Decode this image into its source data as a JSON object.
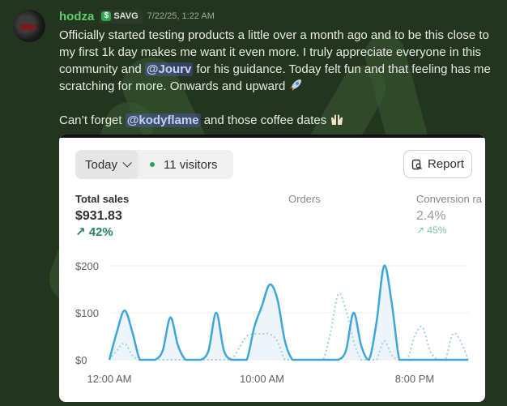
{
  "message": {
    "username": "hodza",
    "server_tag": "SAVG",
    "timestamp": "7/22/25, 1:22 AM",
    "line1_a": "Officially started testing products a little over a month ago and to be this close to my first 1k day makes me want it even more. I truly appreciate everyone in this community and ",
    "mention1": "@Jourv",
    "line1_b": " for his guidance. Today felt fun and that feeling has me scratching for more. Onwards and upward ",
    "line2_a": "Can’t forget ",
    "mention2": "@kodyflame",
    "line2_b": " and those coffee dates ",
    "emoji1": "rocket-icon",
    "emoji2": "raised-hands-icon"
  },
  "dashboard": {
    "range_label": "Today",
    "visitors": "11 visitors",
    "report_label": "Report",
    "metrics": [
      {
        "label": "Total sales",
        "value": "$931.83",
        "change": "↗ 42%"
      },
      {
        "label": "Orders",
        "value": "",
        "change": ""
      },
      {
        "label": "Conversion ra",
        "value": "2.4%",
        "change": "↗ 45%"
      }
    ],
    "colors": {
      "primary_line": "#3ea6d8",
      "comparison_line": "#9fd0ea",
      "fill": "#e8f3fa",
      "positive": "#29845a"
    }
  },
  "chart_data": {
    "type": "line",
    "y_ticks": [
      "$200",
      "$100",
      "$0"
    ],
    "x_ticks": [
      "12:00 AM",
      "10:00 AM",
      "8:00 PM"
    ],
    "ylim": [
      0,
      200
    ],
    "x": [
      0,
      0.5,
      1,
      1.5,
      2,
      2.5,
      3,
      3.5,
      4,
      4.5,
      5,
      5.5,
      6,
      6.5,
      7,
      7.5,
      8,
      8.5,
      9,
      9.5,
      10,
      10.5,
      11,
      11.5,
      12,
      12.5,
      13,
      13.5,
      14,
      14.5,
      15,
      15.5,
      16,
      16.5,
      17,
      17.5,
      18,
      18.5,
      19,
      19.5,
      20,
      20.5,
      21,
      21.5,
      22,
      22.5,
      23,
      23.5
    ],
    "series": [
      {
        "values": [
          0,
          60,
          105,
          60,
          0,
          0,
          0,
          20,
          90,
          30,
          0,
          0,
          0,
          20,
          100,
          20,
          0,
          0,
          0,
          70,
          115,
          160,
          130,
          40,
          0,
          0,
          0,
          0,
          0,
          0,
          0,
          20,
          100,
          30,
          0,
          80,
          200,
          120,
          0,
          0,
          0,
          0,
          0,
          0,
          0,
          0,
          0,
          0
        ]
      },
      {
        "values": [
          0,
          20,
          35,
          10,
          0,
          0,
          0,
          0,
          0,
          0,
          0,
          0,
          0,
          0,
          0,
          0,
          0,
          25,
          50,
          55,
          55,
          55,
          40,
          0,
          0,
          0,
          0,
          0,
          0,
          60,
          140,
          105,
          40,
          0,
          0,
          0,
          40,
          10,
          0,
          0,
          50,
          70,
          20,
          0,
          0,
          55,
          40,
          0
        ]
      }
    ]
  }
}
